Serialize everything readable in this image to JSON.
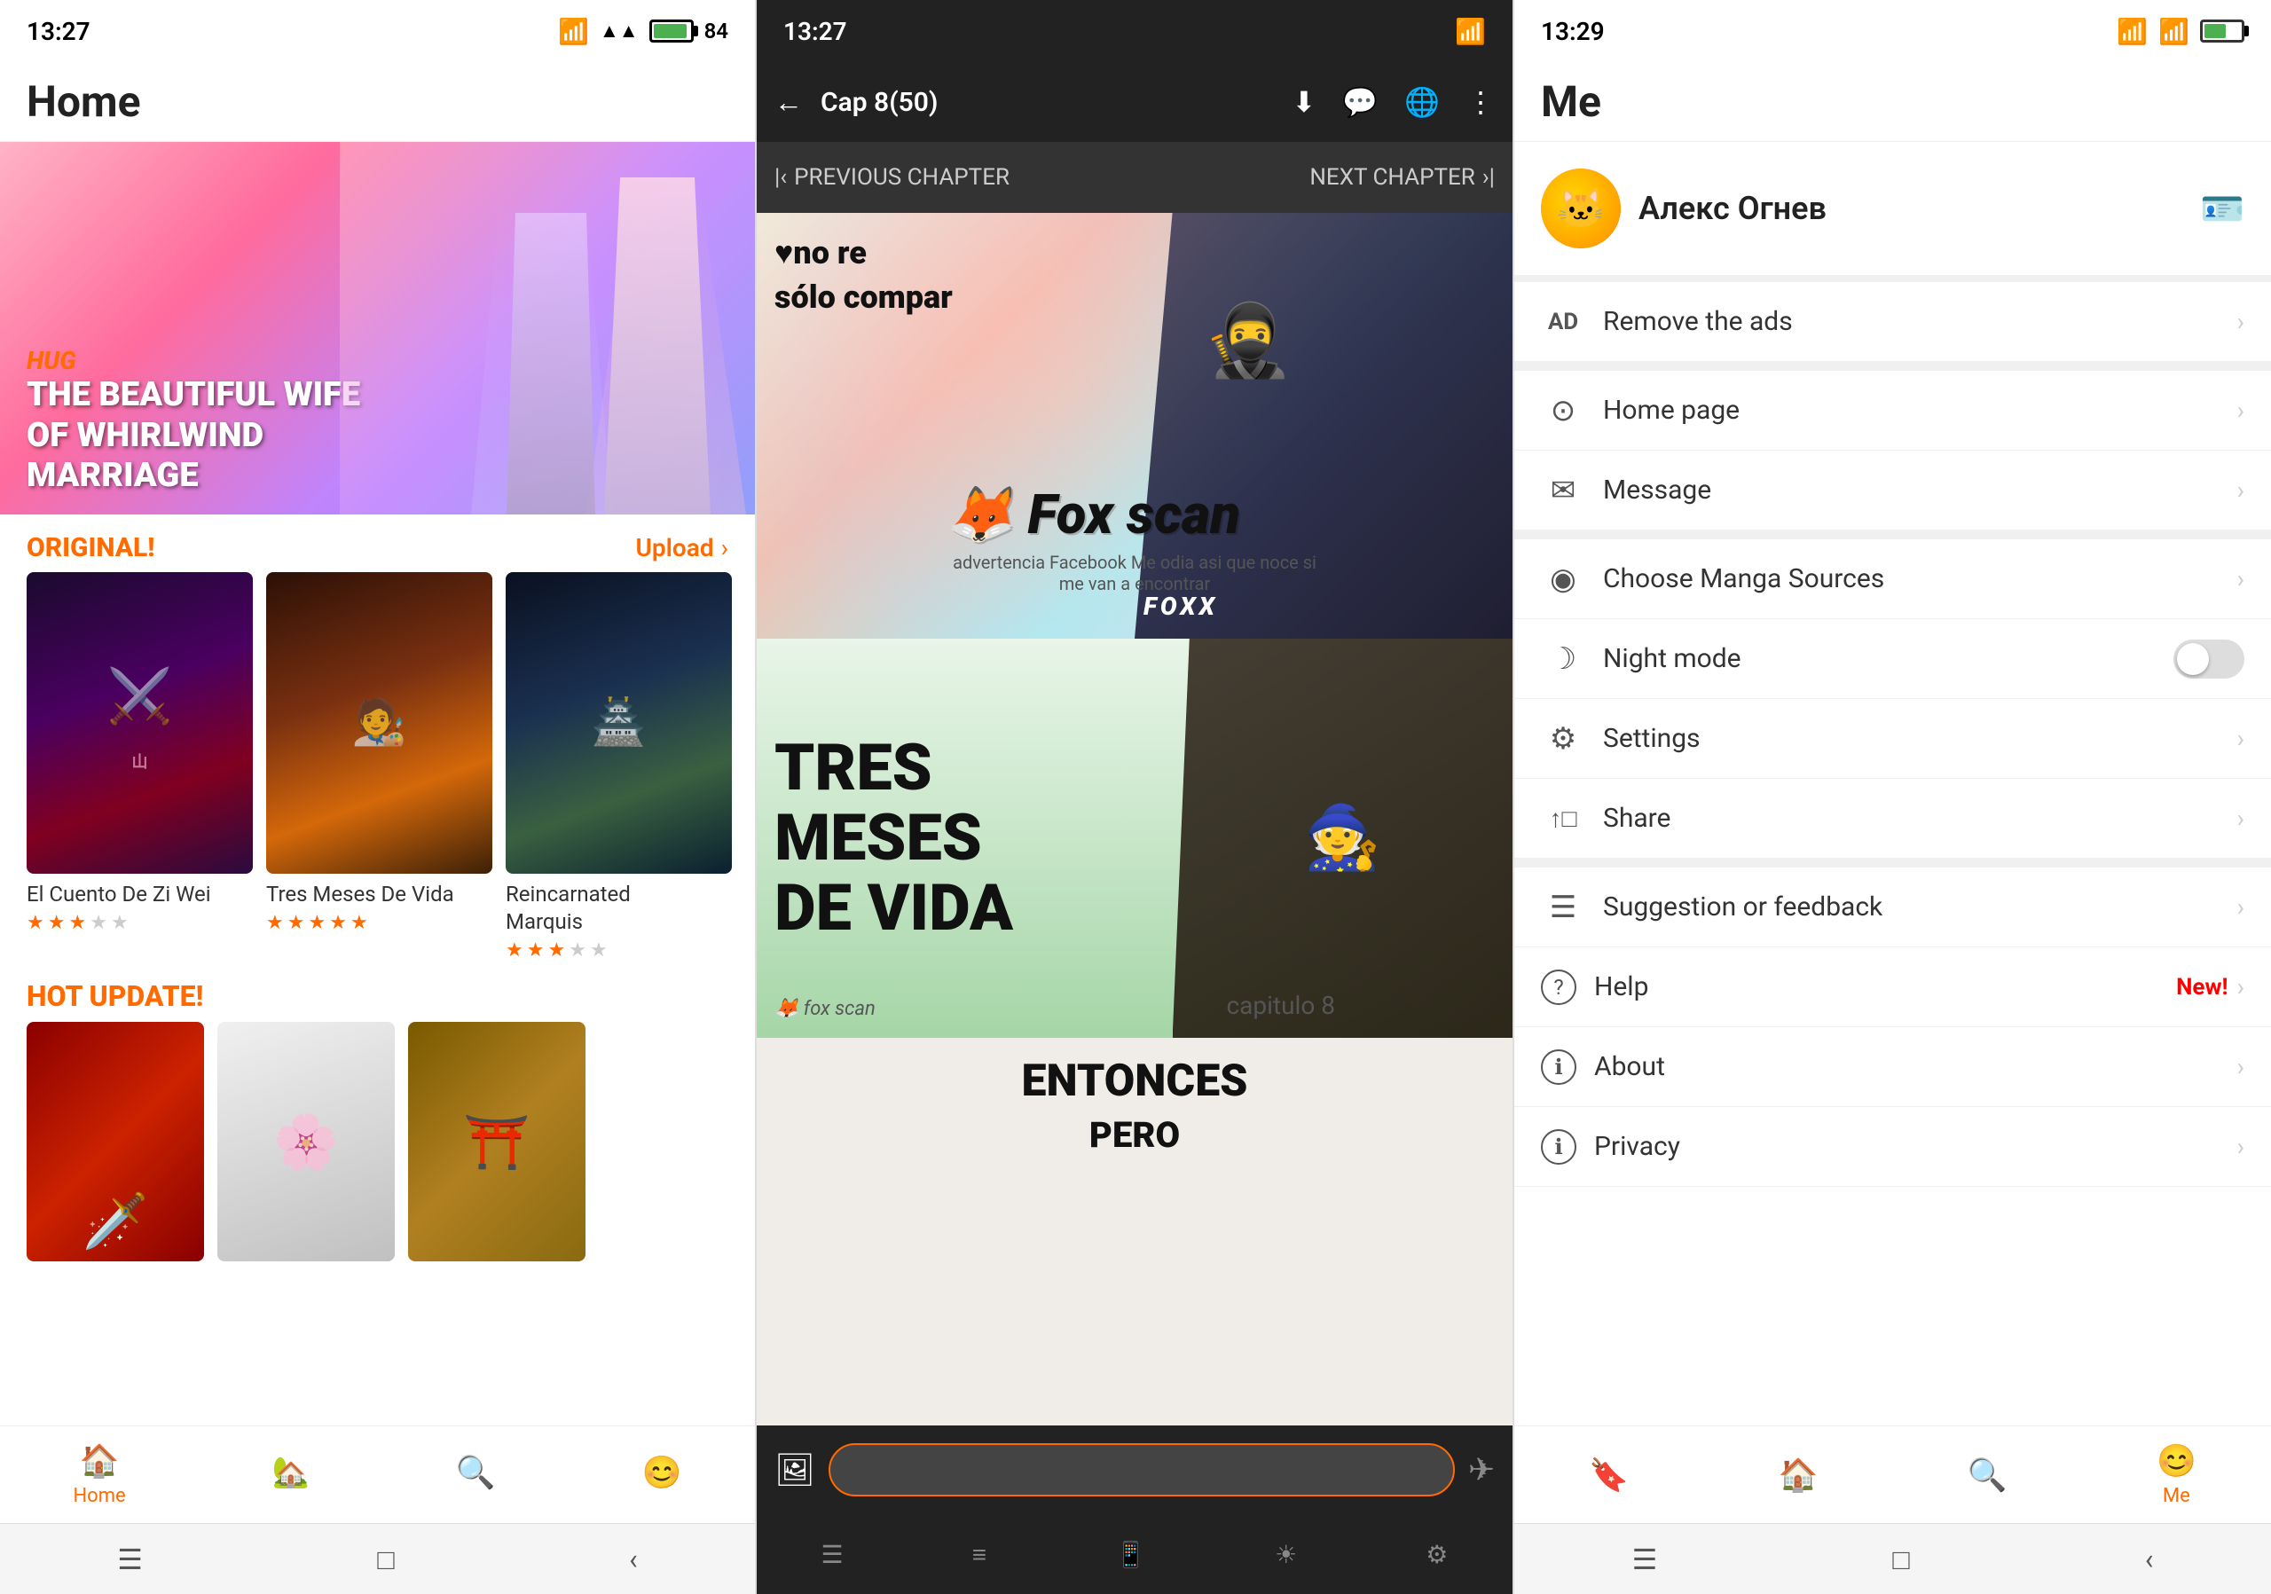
{
  "phone1": {
    "status": {
      "time": "13:27",
      "battery": 84
    },
    "header": {
      "title": "Home"
    },
    "banner": {
      "tag": "HUG",
      "title": "THE BEAUTIFUL WIFE\nOF WHIRLWIND\nMARRIAGE"
    },
    "original_section": {
      "label": "ORIGINAL!",
      "upload": "Upload",
      "arrow": "›"
    },
    "manga_items": [
      {
        "title": "El Cuento De Zi Wei",
        "stars_filled": 3,
        "stars_empty": 2
      },
      {
        "title": "Tres Meses De Vida",
        "stars_filled": 5,
        "stars_empty": 0
      },
      {
        "title": "Reincarnated Marquis",
        "stars_filled": 3,
        "stars_empty": 2
      }
    ],
    "hot_update": {
      "label": "HOT UPDATE!"
    },
    "bottom_nav": [
      {
        "icon": "🏠",
        "label": "Home",
        "active": true
      },
      {
        "icon": "🏡",
        "label": "",
        "active": false
      },
      {
        "icon": "🔍",
        "label": "",
        "active": false
      },
      {
        "icon": "😊",
        "label": "",
        "active": false
      }
    ]
  },
  "phone2": {
    "status": {
      "time": "13:27"
    },
    "header": {
      "back": "←",
      "chapter": "Cap 8(50)"
    },
    "nav": {
      "prev": "PREVIOUS CHAPTER",
      "next": "NEXT CHAPTER"
    },
    "pages": [
      {
        "watermark": "Fox scan",
        "text1": "♥no re\nsolo compar",
        "subtitle": "advertencia Facebook Me odia asi que noce si me van a encontrar"
      },
      {
        "title": "TRES\nMESES\nDE VIDA",
        "capitulo": "capitulo 8"
      },
      {
        "text": "ENTONCES\nPERO"
      }
    ],
    "chat_placeholder": ""
  },
  "phone3": {
    "status": {
      "time": "13:29"
    },
    "header": {
      "title": "Me"
    },
    "profile": {
      "username": "Алекс Огнев"
    },
    "menu_items": [
      {
        "icon": "AD",
        "label": "Remove the ads",
        "type": "arrow",
        "icon_type": "text"
      },
      {
        "icon": "⊙",
        "label": "Home page",
        "type": "arrow"
      },
      {
        "icon": "✉",
        "label": "Message",
        "type": "arrow"
      },
      {
        "icon": "◎",
        "label": "Choose Manga Sources",
        "type": "arrow"
      },
      {
        "icon": "☾",
        "label": "Night mode",
        "type": "toggle"
      },
      {
        "icon": "⚙",
        "label": "Settings",
        "type": "arrow"
      },
      {
        "icon": "↑",
        "label": "Share",
        "type": "arrow"
      },
      {
        "icon": "☰",
        "label": "Suggestion or feedback",
        "type": "arrow"
      },
      {
        "icon": "?",
        "label": "Help",
        "badge": "New!",
        "type": "arrow"
      },
      {
        "icon": "ℹ",
        "label": "About",
        "type": "arrow"
      },
      {
        "icon": "🔒",
        "label": "Privacy",
        "type": "arrow"
      }
    ],
    "bottom_nav": [
      {
        "icon": "🔖",
        "label": "",
        "active": false
      },
      {
        "icon": "🏠",
        "label": "",
        "active": false
      },
      {
        "icon": "🔍",
        "label": "",
        "active": false
      },
      {
        "icon": "👤",
        "label": "Me",
        "active": true
      }
    ]
  }
}
